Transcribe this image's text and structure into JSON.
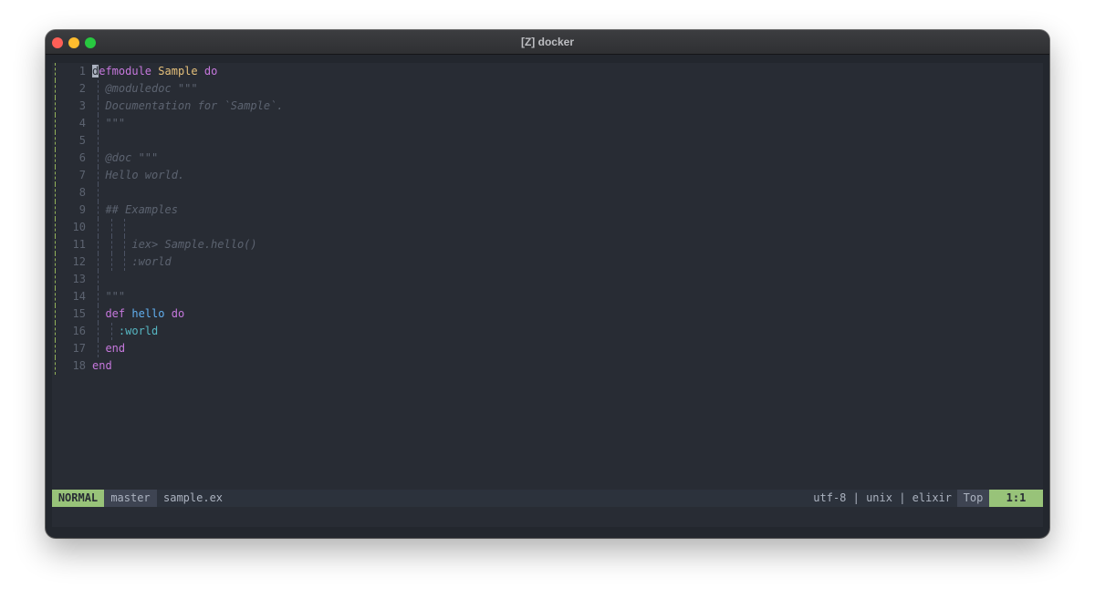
{
  "window": {
    "title": "[Z] docker"
  },
  "editor": {
    "lines": [
      {
        "n": "1",
        "tokens": [
          [
            "cursor",
            "d"
          ],
          [
            "k",
            "efmodule "
          ],
          [
            "m",
            "Sample"
          ],
          [
            "t",
            " "
          ],
          [
            "k",
            "do"
          ]
        ]
      },
      {
        "n": "2",
        "guides": [
          1
        ],
        "tokens": [
          [
            "t",
            "  "
          ],
          [
            "c",
            "@moduledoc \"\"\""
          ]
        ]
      },
      {
        "n": "3",
        "guides": [
          1
        ],
        "tokens": [
          [
            "t",
            "  "
          ],
          [
            "c",
            "Documentation for `Sample`."
          ]
        ]
      },
      {
        "n": "4",
        "guides": [
          1
        ],
        "tokens": [
          [
            "t",
            "  "
          ],
          [
            "c",
            "\"\"\""
          ]
        ]
      },
      {
        "n": "5",
        "guides": [
          1
        ],
        "tokens": []
      },
      {
        "n": "6",
        "guides": [
          1
        ],
        "tokens": [
          [
            "t",
            "  "
          ],
          [
            "c",
            "@doc \"\"\""
          ]
        ]
      },
      {
        "n": "7",
        "guides": [
          1
        ],
        "tokens": [
          [
            "t",
            "  "
          ],
          [
            "c",
            "Hello world."
          ]
        ]
      },
      {
        "n": "8",
        "guides": [
          1
        ],
        "tokens": []
      },
      {
        "n": "9",
        "guides": [
          1
        ],
        "tokens": [
          [
            "t",
            "  "
          ],
          [
            "c",
            "## Examples"
          ]
        ]
      },
      {
        "n": "10",
        "guides": [
          1,
          2,
          3
        ],
        "tokens": []
      },
      {
        "n": "11",
        "guides": [
          1,
          2,
          3
        ],
        "tokens": [
          [
            "t",
            "      "
          ],
          [
            "c",
            "iex> Sample.hello()"
          ]
        ]
      },
      {
        "n": "12",
        "guides": [
          1,
          2,
          3
        ],
        "tokens": [
          [
            "t",
            "      "
          ],
          [
            "c",
            ":world"
          ]
        ]
      },
      {
        "n": "13",
        "guides": [
          1
        ],
        "tokens": []
      },
      {
        "n": "14",
        "guides": [
          1
        ],
        "tokens": [
          [
            "t",
            "  "
          ],
          [
            "c",
            "\"\"\""
          ]
        ]
      },
      {
        "n": "15",
        "guides": [
          1
        ],
        "tokens": [
          [
            "t",
            "  "
          ],
          [
            "k",
            "def "
          ],
          [
            "f",
            "hello"
          ],
          [
            "t",
            " "
          ],
          [
            "k",
            "do"
          ]
        ]
      },
      {
        "n": "16",
        "guides": [
          1,
          2
        ],
        "tokens": [
          [
            "t",
            "    "
          ],
          [
            "a",
            ":world"
          ]
        ]
      },
      {
        "n": "17",
        "guides": [
          1
        ],
        "tokens": [
          [
            "t",
            "  "
          ],
          [
            "k",
            "end"
          ]
        ]
      },
      {
        "n": "18",
        "tokens": [
          [
            "k",
            "end"
          ]
        ]
      }
    ]
  },
  "status": {
    "mode": "NORMAL",
    "branch": "master",
    "file": "sample.ex",
    "info": "utf-8 | unix | elixir",
    "scroll": "Top",
    "position": "1:1"
  },
  "colors": {
    "background": "#282c34",
    "keyword": "#c678dd",
    "module": "#e5c07b",
    "function": "#61afef",
    "atom": "#56b6c2",
    "comment": "#5c6370",
    "mode_bg": "#98c379"
  }
}
